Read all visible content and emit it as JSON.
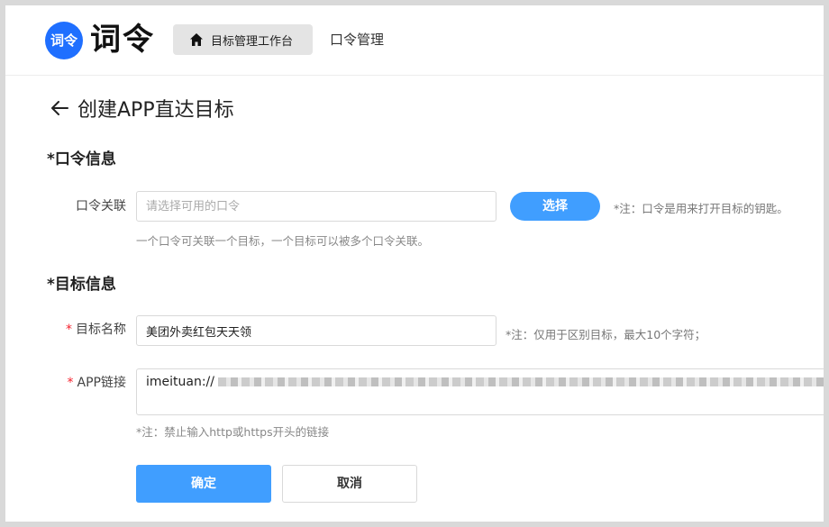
{
  "header": {
    "logo_badge": "词令",
    "logo_text": "词令",
    "nav": [
      {
        "label": "目标管理工作台",
        "active": true
      },
      {
        "label": "口令管理",
        "active": false
      }
    ]
  },
  "page": {
    "title": "创建APP直达目标"
  },
  "command_section": {
    "title": "*口令信息",
    "field_label": "口令关联",
    "placeholder": "请选择可用的口令",
    "select_button": "选择",
    "note": "*注：口令是用来打开目标的钥匙。",
    "help": "一个口令可关联一个目标，一个目标可以被多个口令关联。"
  },
  "target_section": {
    "title": "*目标信息",
    "name_label": "目标名称",
    "name_value": "美团外卖红包天天领",
    "name_note": "*注：仅用于区别目标，最大10个字符；",
    "link_label": "APP链接",
    "link_value": "imeituan://",
    "link_note": "*注：禁止输入http或https开头的链接",
    "required_mark": "*"
  },
  "actions": {
    "confirm": "确定",
    "cancel": "取消"
  },
  "colors": {
    "primary": "#409eff",
    "logo_blue": "#1f6fff",
    "required_red": "#f5222d"
  }
}
